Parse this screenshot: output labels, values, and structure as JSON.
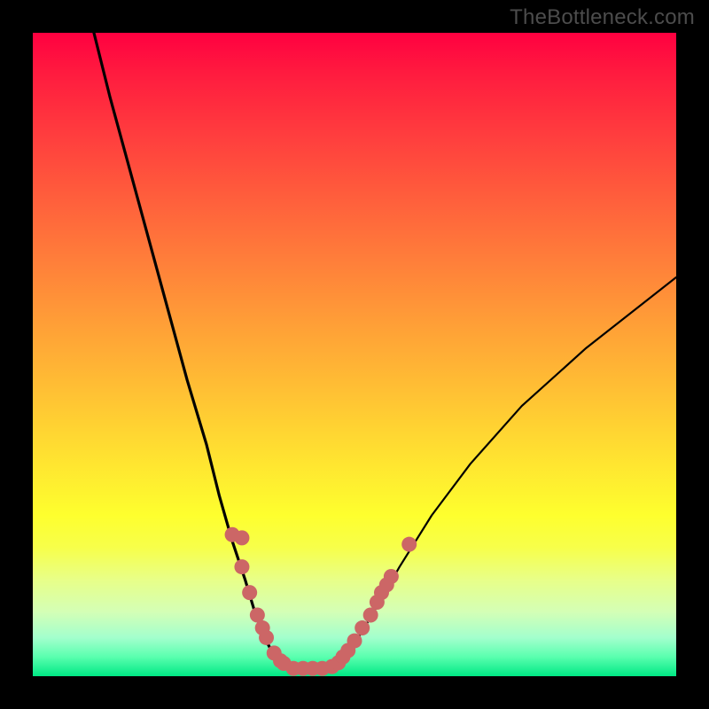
{
  "watermark": "TheBottleneck.com",
  "chart_data": {
    "type": "line",
    "title": "",
    "xlabel": "",
    "ylabel": "",
    "xlim": [
      0,
      100
    ],
    "ylim": [
      0,
      100
    ],
    "series": [
      {
        "name": "curve-left",
        "x": [
          9.5,
          12,
          15,
          18,
          21,
          24,
          27,
          29,
          31,
          33,
          34.5,
          36,
          38,
          40
        ],
        "values": [
          100,
          90,
          79,
          68,
          57,
          46,
          36,
          28,
          21,
          15,
          10,
          6,
          2.3,
          1.2
        ]
      },
      {
        "name": "curve-right",
        "x": [
          46,
          48,
          50,
          53,
          57,
          62,
          68,
          76,
          86,
          100
        ],
        "values": [
          1.2,
          2.4,
          5,
          10,
          17,
          25,
          33,
          42,
          51,
          62
        ]
      },
      {
        "name": "floor",
        "x": [
          40,
          46
        ],
        "values": [
          1.2,
          1.2
        ]
      }
    ],
    "markers": {
      "name": "highlight-dots",
      "points": [
        {
          "x": 31,
          "y": 22
        },
        {
          "x": 32.5,
          "y": 17
        },
        {
          "x": 32.5,
          "y": 21.5
        },
        {
          "x": 33.7,
          "y": 13
        },
        {
          "x": 34.9,
          "y": 9.5
        },
        {
          "x": 35.7,
          "y": 7.5
        },
        {
          "x": 36.3,
          "y": 6
        },
        {
          "x": 37.5,
          "y": 3.6
        },
        {
          "x": 38.5,
          "y": 2.4
        },
        {
          "x": 39,
          "y": 2
        },
        {
          "x": 40.5,
          "y": 1.2
        },
        {
          "x": 42,
          "y": 1.2
        },
        {
          "x": 43.5,
          "y": 1.2
        },
        {
          "x": 45,
          "y": 1.2
        },
        {
          "x": 46.5,
          "y": 1.5
        },
        {
          "x": 47.5,
          "y": 2.1
        },
        {
          "x": 48.2,
          "y": 3
        },
        {
          "x": 49,
          "y": 4
        },
        {
          "x": 50,
          "y": 5.5
        },
        {
          "x": 51.2,
          "y": 7.5
        },
        {
          "x": 52.5,
          "y": 9.5
        },
        {
          "x": 53.5,
          "y": 11.5
        },
        {
          "x": 54.2,
          "y": 13
        },
        {
          "x": 55,
          "y": 14.2
        },
        {
          "x": 55.7,
          "y": 15.5
        },
        {
          "x": 58.5,
          "y": 20.5
        }
      ]
    },
    "colors": {
      "curve": "#000000",
      "marker": "#cc6666",
      "gradient_top": "#ff0040",
      "gradient_bottom": "#00e884",
      "background": "#000000"
    }
  }
}
